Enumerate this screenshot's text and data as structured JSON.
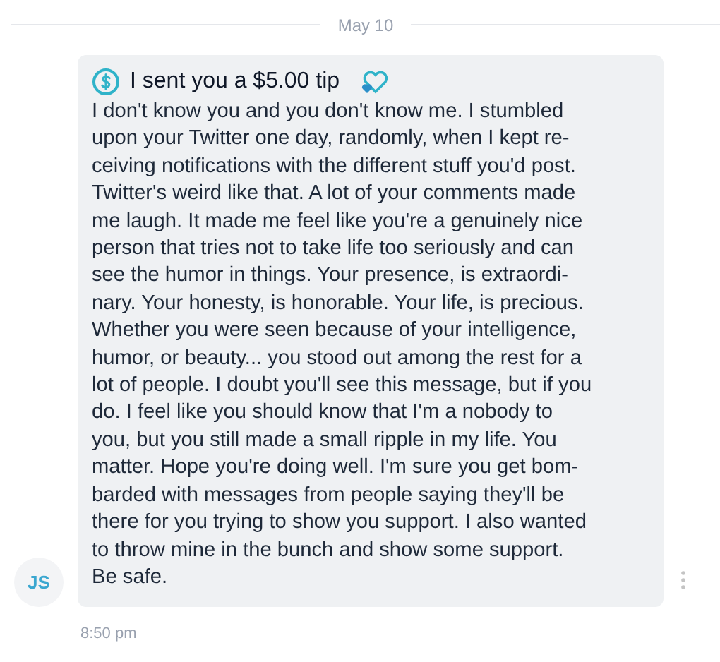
{
  "date_divider": "May 10",
  "message": {
    "sender_initials": "JS",
    "tip_title": "I sent you a $5.00 tip",
    "body": "I don't know you and you don't know me. I stumbled\nupon your Twitter one day, randomly, when I kept re-\nceiving notifications with the different stuff you'd post.\nTwitter's weird like that. A lot of your comments made\nme laugh. It made me feel like you're a genuinely nice\nperson that tries not to take life too seriously and can\nsee the humor in things. Your presence, is extraordi-\nnary. Your honesty, is honorable. Your life, is precious.\nWhether you were seen because of your intelligence,\nhumor, or beauty... you stood out among the rest for a\nlot of people. I doubt you'll see this message, but if you\ndo. I feel like you should know that I'm a nobody to\nyou, but you still made a small ripple in my life. You\nmatter. Hope you're doing well. I'm sure you get bom-\nbarded with messages from people saying they'll be\nthere for you trying to show you support. I also wanted\nto throw mine in the bunch and show some support.\nBe safe.",
    "time": "8:50 pm"
  }
}
